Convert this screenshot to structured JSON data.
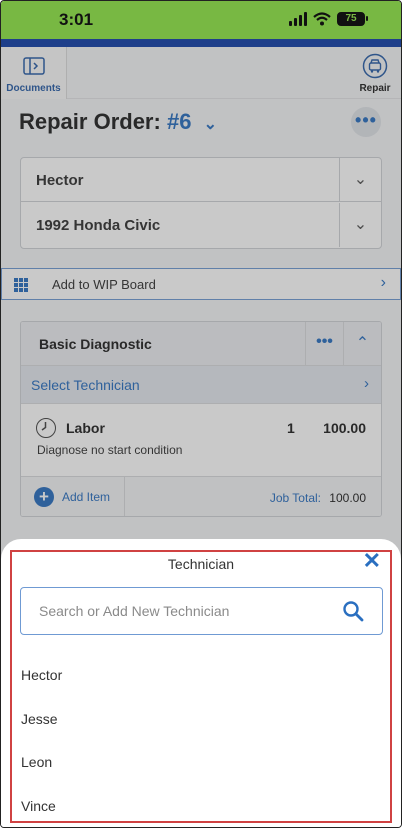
{
  "status_bar": {
    "time": "3:01",
    "battery": "75"
  },
  "toolbar": {
    "documents_label": "Documents",
    "repair_label": "Repair"
  },
  "repair_order": {
    "title_label": "Repair Order:",
    "number": "#6"
  },
  "customer": "Hector",
  "vehicle": "1992 Honda Civic",
  "wip": {
    "label": "Add to WIP Board"
  },
  "job": {
    "title": "Basic Diagnostic",
    "select_technician": "Select Technician",
    "labor": {
      "title": "Labor",
      "qty": "1",
      "price": "100.00",
      "description": "Diagnose no start condition"
    },
    "add_item": "Add Item",
    "total_label": "Job Total:",
    "total_value": "100.00"
  },
  "sheet": {
    "title": "Technician",
    "search_placeholder": "Search or Add New Technician",
    "technicians": [
      "Hector",
      "Jesse",
      "Leon",
      "Vince"
    ]
  },
  "colors": {
    "accent": "#2a6fc0",
    "status_bar": "#78b843",
    "header": "#1e3f8a",
    "highlight": "#d04242"
  }
}
